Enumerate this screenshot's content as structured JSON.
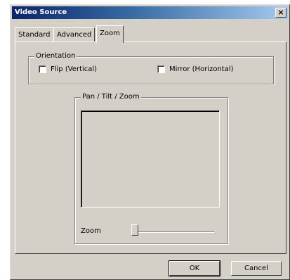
{
  "window": {
    "title": "Video Source",
    "close_glyph": "×"
  },
  "tabs": [
    {
      "label": "Standard",
      "active": false
    },
    {
      "label": "Advanced",
      "active": false
    },
    {
      "label": "Zoom",
      "active": true
    }
  ],
  "orientation": {
    "legend": "Orientation",
    "flip_label": "Flip (Vertical)",
    "flip_checked": false,
    "mirror_label": "Mirror (Horizontal)",
    "mirror_checked": false
  },
  "ptz": {
    "legend": "Pan / Tilt / Zoom",
    "zoom_label": "Zoom",
    "zoom_value": 0
  },
  "buttons": {
    "ok": "OK",
    "cancel": "Cancel"
  },
  "colors": {
    "face": "#d4d0c8",
    "title_start": "#0a246a",
    "title_end": "#a6caf0"
  }
}
